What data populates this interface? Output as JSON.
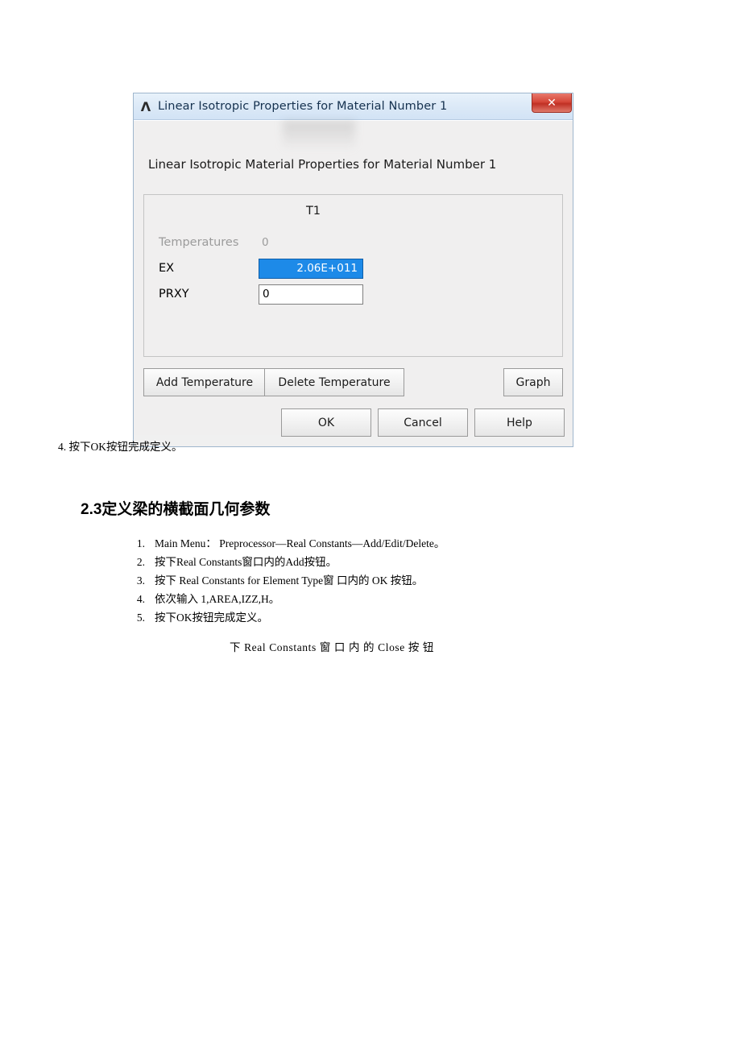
{
  "dialog": {
    "icon": "ansys-lambda-icon",
    "title": "Linear Isotropic Properties for Material Number 1",
    "close_label": "✕",
    "heading": "Linear Isotropic Material Properties for Material Number 1",
    "table": {
      "column_header": "T1",
      "rows": [
        {
          "label": "Temperatures",
          "value": "0",
          "state": "readonly"
        },
        {
          "label": "EX",
          "value": "2.06E+011",
          "state": "selected"
        },
        {
          "label": "PRXY",
          "value": "0",
          "state": "input"
        }
      ]
    },
    "buttons": {
      "add_temperature": "Add Temperature",
      "delete_temperature": "Delete Temperature",
      "graph": "Graph",
      "ok": "OK",
      "cancel": "Cancel",
      "help": "Help"
    },
    "colors": {
      "selection_blue": "#1d8ae8",
      "close_red": "#d6483a",
      "titlebar_blue": "#dce9f7"
    }
  },
  "document": {
    "caption_line": "4. 按下OK按钮完成定义。",
    "section_title": "2.3定义梁的横截面几何参数",
    "steps": [
      {
        "num": "1.",
        "text": "Main Menu：  Preprocessor—Real Constants—Add/Edit/Delete。"
      },
      {
        "num": "2.",
        "text": "按下Real Constants窗口内的Add按钮。"
      },
      {
        "num": "3.",
        "text": "按下  Real Constants for Element Type窗 口内的  OK 按钮。"
      },
      {
        "num": "4.",
        "text": "依次输入  1,AREA,IZZ,H。"
      },
      {
        "num": "5.",
        "text": "按下OK按钮完成定义。"
      }
    ],
    "trailing_line": "下  Real Constants 窗  口  内  的  Close 按  钮"
  }
}
